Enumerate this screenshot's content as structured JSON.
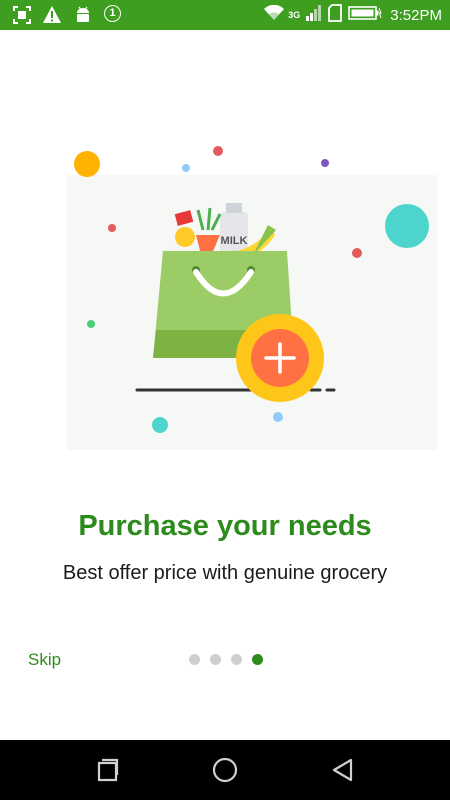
{
  "status_bar": {
    "notification_count": "1",
    "network_type": "3G",
    "time": "3:52PM"
  },
  "onboarding": {
    "title": "Purchase your needs",
    "subtitle": "Best offer price with genuine grocery",
    "illustration_label": "MILK",
    "skip_label": "Skip",
    "page_count": 4,
    "current_page": 4
  },
  "colors": {
    "accent": "#2d8a1d",
    "status_bar": "#3d9e1f",
    "bag": "#8bc34a",
    "plus_button": "#ff7043",
    "plus_ring": "#ffc61a"
  },
  "icons": {
    "screenshot": "screenshot-icon",
    "warning": "warning-icon",
    "android": "android-icon",
    "wifi": "wifi-icon",
    "signal": "signal-icon",
    "sim": "sim-icon",
    "battery": "battery-icon",
    "nav_recent": "recent-apps-icon",
    "nav_home": "home-icon",
    "nav_back": "back-icon"
  }
}
